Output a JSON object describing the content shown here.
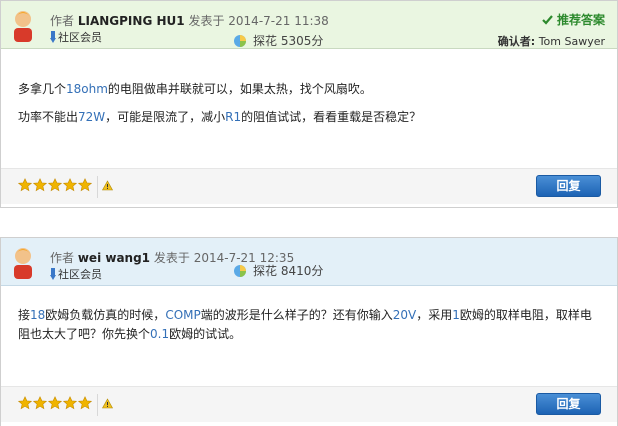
{
  "posts": [
    {
      "author_prefix": "作者",
      "author": "LIANGPING HU1",
      "posted_prefix": "发表于",
      "date": "2014-7-21 11:38",
      "role": "社区会员",
      "points_label": "探花",
      "points_value": "5305分",
      "accepted_label": "推荐答案",
      "confirm_label": "确认者:",
      "confirm_user": "Tom Sawyer",
      "body_lines": [
        {
          "a": "多拿几个",
          "n1": "18ohm",
          "b": "的电阻做串并联就可以，如果太热，找个风扇吹。"
        },
        {
          "a": "功率不能出",
          "n1": "72W",
          "b": "，可能是限流了，减小",
          "n2": "R1",
          "c": "的阻值试试，看看重载是否稳定？"
        }
      ],
      "rating": 5,
      "reply_label": "回复"
    },
    {
      "author_prefix": "作者",
      "author": "wei wang1",
      "posted_prefix": "发表于",
      "date": "2014-7-21 12:35",
      "role": "社区会员",
      "points_label": "探花",
      "points_value": "8410分",
      "body_lines": [
        {
          "a": "接",
          "n1": "18",
          "b": "欧姆负载仿真的时候，",
          "n2": "COMP",
          "c": "端的波形是什么样子的？还有你输入",
          "n3": "20V",
          "d": "，采用",
          "n4": "1",
          "e": "欧姆的取样电阻，取样电"
        },
        {
          "a": "阻也太大了吧？你先换个",
          "n1": "0.1",
          "b": "欧姆的试试。"
        }
      ],
      "rating": 5,
      "reply_label": "回复"
    }
  ],
  "colors": {
    "accent": "#1d63b4",
    "accepted": "#2d8a2d",
    "number": "#3470b7",
    "star": "#f0b400"
  },
  "icons": [
    "avatar",
    "member-icon",
    "points-icon",
    "check-icon",
    "star-icon",
    "report-icon"
  ]
}
